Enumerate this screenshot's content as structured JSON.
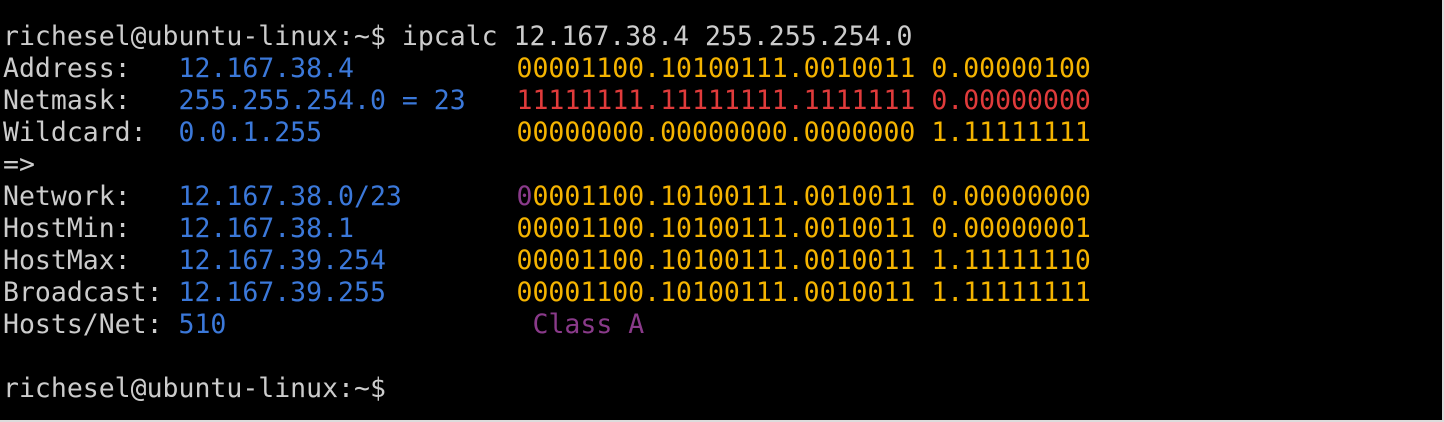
{
  "terminal": {
    "prompt": "richesel@ubuntu-linux:~$",
    "command": " ipcalc 12.167.38.4 255.255.254.0",
    "rows": {
      "address": {
        "label": "Address:   ",
        "value": "12.167.38.4",
        "bin": "00001100.10100111.0010011 0.00000100"
      },
      "netmask": {
        "label": "Netmask:   ",
        "value": "255.255.254.0 = 23",
        "bin_net": "11111111.11111111.1111111",
        "bin_host": " 0.00000000"
      },
      "wildcard": {
        "label": "Wildcard:  ",
        "value": "0.0.1.255",
        "bin": "00000000.00000000.0000000 1.11111111"
      },
      "arrow": "=>",
      "network": {
        "label": "Network:   ",
        "value": "12.167.38.0/23",
        "class_bit": "0",
        "bin": "0001100.10100111.0010011 0.00000000"
      },
      "hostmin": {
        "label": "HostMin:   ",
        "value": "12.167.38.1",
        "bin": "00001100.10100111.0010011 0.00000001"
      },
      "hostmax": {
        "label": "HostMax:   ",
        "value": "12.167.39.254",
        "bin": "00001100.10100111.0010011 1.11111110"
      },
      "broadcast": {
        "label": "Broadcast: ",
        "value": "12.167.39.255",
        "bin": "00001100.10100111.0010011 1.11111111"
      },
      "hosts": {
        "label": "Hosts/Net: ",
        "value": "510",
        "class": "Class A"
      }
    },
    "final_prompt": "richesel@ubuntu-linux:~$"
  },
  "colors": {
    "background": "#000000",
    "text": "#cccccc",
    "value": "#3b78d9",
    "binary": "#f5b400",
    "netmask": "#e03b3b",
    "class": "#8a3a8a"
  }
}
